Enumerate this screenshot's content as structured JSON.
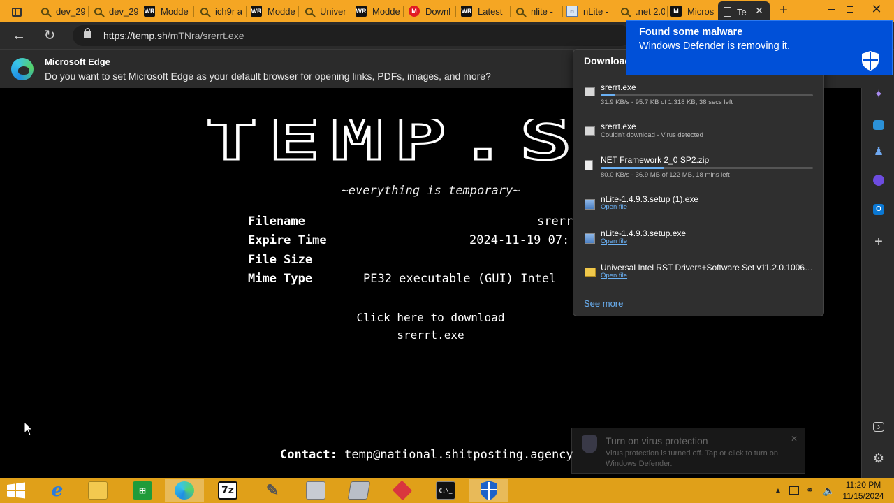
{
  "browser": {
    "tabs": [
      {
        "label": "dev_29",
        "icon": "search-icon"
      },
      {
        "label": "dev_29",
        "icon": "search-icon"
      },
      {
        "label": "Modde",
        "icon": "wr-icon"
      },
      {
        "label": "ich9r a",
        "icon": "search-icon"
      },
      {
        "label": "Modde",
        "icon": "wr-icon"
      },
      {
        "label": "Univer",
        "icon": "search-icon"
      },
      {
        "label": "Modde",
        "icon": "wr-icon"
      },
      {
        "label": "Downl",
        "icon": "m-icon"
      },
      {
        "label": "Latest",
        "icon": "wr-icon"
      },
      {
        "label": "nlite -",
        "icon": "search-icon"
      },
      {
        "label": "nLite -",
        "icon": "nlite-icon"
      },
      {
        "label": ".net 2.0",
        "icon": "search-icon"
      },
      {
        "label": "Micros",
        "icon": "ms-icon"
      }
    ],
    "active_tab": {
      "label": "Te",
      "icon": "page-icon"
    },
    "url": {
      "host": "https://temp.sh",
      "path": "/mTNra/srerrt.exe"
    }
  },
  "infobar": {
    "title": "Microsoft Edge",
    "text": "Do you want to set Microsoft Edge as your default browser for opening links, PDFs, images, and more?"
  },
  "page": {
    "logo_text": "TEMP.S",
    "tagline": "~everything is temporary~",
    "meta": [
      {
        "label": "Filename",
        "value": "srerr"
      },
      {
        "label": "Expire Time",
        "value": "2024-11-19 07:"
      },
      {
        "label": "File Size",
        "value": ""
      },
      {
        "label": "Mime Type",
        "value": "PE32 executable (GUI) Intel"
      }
    ],
    "download_line1": "Click here to download",
    "download_line2": "srerrt.exe",
    "contact_label": "Contact:",
    "contact_email": "temp@national.shitposting.agency"
  },
  "downloads": {
    "title": "Download",
    "items": [
      {
        "name": "srerrt.exe",
        "icon": "exe-icon",
        "progress": 0.07,
        "status": "31.9 KB/s - 95.7 KB of 1,318 KB, 38 secs left",
        "open": ""
      },
      {
        "name": "srerrt.exe",
        "icon": "exe-icon",
        "progress": null,
        "status": "Couldn't download - Virus detected",
        "open": ""
      },
      {
        "name": "NET Framework 2_0 SP2.zip",
        "icon": "zip-icon",
        "progress": 0.3,
        "status": "80.0 KB/s - 36.9 MB of 122 MB, 18 mins left",
        "open": ""
      },
      {
        "name": "nLite-1.4.9.3.setup (1).exe",
        "icon": "setup-icon",
        "progress": null,
        "status": "",
        "open": "Open file"
      },
      {
        "name": "nLite-1.4.9.3.setup.exe",
        "icon": "setup-icon",
        "progress": null,
        "status": "",
        "open": "Open file"
      },
      {
        "name": "Universal Intel RST Drivers+Software Set v11.2.0.1006 m...",
        "icon": "folder-icon",
        "progress": null,
        "status": "",
        "open": "Open file"
      }
    ],
    "see_more": "See more"
  },
  "toast": {
    "title": "Found some malware",
    "text": "Windows Defender is removing it."
  },
  "toast_faded": {
    "title": "Turn on virus protection",
    "text": "Virus protection is turned off. Tap or click to turn on Windows Defender."
  },
  "taskbar": {
    "apps": [
      "ie",
      "file-explorer",
      "store",
      "edge",
      "7zip",
      "tool",
      "installer",
      "network-tool",
      "gitkraken",
      "cmd",
      "defender"
    ],
    "time": "11:20 PM",
    "date": "11/15/2024"
  },
  "colors": {
    "accent": "#f5a623",
    "taskbar": "#e0a019",
    "toast": "#0050d8",
    "link": "#6ab0f3"
  }
}
